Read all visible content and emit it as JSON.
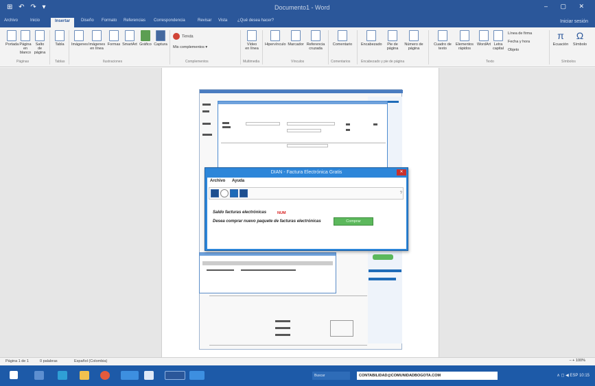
{
  "titlebar": {
    "qat": "⊞ ↶ ↷ ▾",
    "document_title": "Documento1 - Word",
    "controls": "– ▢ ✕"
  },
  "tabs": [
    "Archivo",
    "Inicio",
    "Insertar",
    "Diseño",
    "Formato",
    "Referencias",
    "Correspondencia",
    "Revisar",
    "Vista",
    "¿Qué desea hacer?"
  ],
  "active_tab": "Insertar",
  "user": "Iniciar sesión",
  "ribbon": {
    "buttons": [
      {
        "label": "Portada",
        "icon": "cover-page-icon"
      },
      {
        "label": "Página en blanco",
        "icon": "blank-page-icon"
      },
      {
        "label": "Salto de página",
        "icon": "page-break-icon"
      },
      {
        "label": "Tabla",
        "icon": "table-icon"
      },
      {
        "label": "Imágenes",
        "icon": "picture-icon"
      },
      {
        "label": "Imágenes en línea",
        "icon": "online-picture-icon"
      },
      {
        "label": "Formas",
        "icon": "shapes-icon"
      },
      {
        "label": "SmartArt",
        "icon": "smartart-icon"
      },
      {
        "label": "Gráfico",
        "icon": "chart-icon"
      },
      {
        "label": "Captura",
        "icon": "screenshot-icon"
      },
      {
        "label": "Vídeo en línea",
        "icon": "video-icon"
      },
      {
        "label": "Hipervínculo",
        "icon": "link-icon"
      },
      {
        "label": "Marcador",
        "icon": "bookmark-icon"
      },
      {
        "label": "Referencia cruzada",
        "icon": "cross-ref-icon"
      },
      {
        "label": "Comentario",
        "icon": "comment-icon"
      },
      {
        "label": "Encabezado",
        "icon": "header-icon"
      },
      {
        "label": "Pie de página",
        "icon": "footer-icon"
      },
      {
        "label": "Número de página",
        "icon": "page-number-icon"
      },
      {
        "label": "Cuadro de texto",
        "icon": "textbox-icon"
      },
      {
        "label": "Elementos rápidos",
        "icon": "quick-parts-icon"
      },
      {
        "label": "WordArt",
        "icon": "wordart-icon"
      },
      {
        "label": "Letra capital",
        "icon": "dropcap-icon"
      },
      {
        "label": "Ecuación",
        "icon": "equation-icon"
      },
      {
        "label": "Símbolo",
        "icon": "symbol-icon"
      }
    ],
    "store": "Tienda",
    "addins": "Mis complementos",
    "text_small": [
      "Línea de firma",
      "Fecha y hora",
      "Objeto"
    ],
    "groups": [
      "Páginas",
      "Tablas",
      "Ilustraciones",
      "Complementos",
      "Multimedia",
      "Vínculos",
      "Comentarios",
      "Encabezado y pie de página",
      "Texto",
      "Símbolos"
    ]
  },
  "dialog": {
    "title": "DIAN - Factura Electrónica Gratis",
    "close": "✕",
    "menu": [
      "Archivo",
      "Ayuda"
    ],
    "status": "?",
    "saldo_label": "Saldo facturas electrónicas",
    "saldo_value": "NUM",
    "comprar_label": "Desea comprar nuevo paquete de facturas electrónicas",
    "comprar_button": "Comprar"
  },
  "statusbar": {
    "page": "Página 1 de 1",
    "words": "0 palabras",
    "language": "Español (Colombia)"
  },
  "taskbar": {
    "search": "Buscar",
    "email": "CONTABILIDAD@COMUNIDADBOGOTA.COM",
    "tray": "∧ ◻ ◀ ESP 10:15"
  },
  "zoom": "–  +  100%",
  "colors": {
    "word_blue": "#2b579a",
    "dialog_blue": "#2d86d9",
    "taskbar": "#1d5aa8",
    "green_button": "#5cb85c"
  }
}
